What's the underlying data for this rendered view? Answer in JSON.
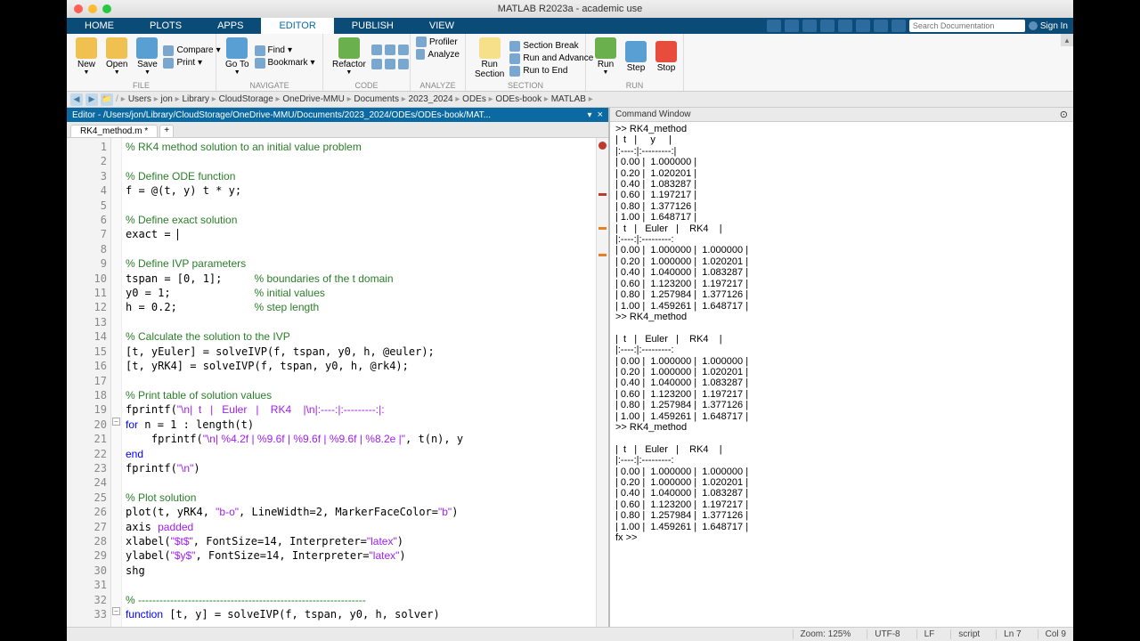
{
  "window_title": "MATLAB R2023a - academic use",
  "tabs": [
    "HOME",
    "PLOTS",
    "APPS",
    "EDITOR",
    "PUBLISH",
    "VIEW"
  ],
  "active_tab": "EDITOR",
  "search_placeholder": "Search Documentation",
  "signin": "Sign In",
  "ribbon": {
    "file": {
      "new": "New",
      "open": "Open",
      "save": "Save",
      "compare": "Compare",
      "print": "Print",
      "label": "FILE"
    },
    "navigate": {
      "goto": "Go To",
      "find": "Find",
      "bookmark": "Bookmark",
      "label": "NAVIGATE"
    },
    "code": {
      "refactor": "Refactor",
      "label": "CODE"
    },
    "analyze": {
      "profiler": "Profiler",
      "analyze": "Analyze",
      "label": "ANALYZE"
    },
    "section": {
      "runsec": "Run\nSection",
      "secbreak": "Section Break",
      "runadv": "Run and Advance",
      "runend": "Run to End",
      "label": "SECTION"
    },
    "run": {
      "run": "Run",
      "step": "Step",
      "stop": "Stop",
      "label": "RUN"
    }
  },
  "breadcrumbs": [
    "Users",
    "jon",
    "Library",
    "CloudStorage",
    "OneDrive-MMU",
    "Documents",
    "2023_2024",
    "ODEs",
    "ODEs-book",
    "MATLAB"
  ],
  "editor_header": "Editor - /Users/jon/Library/CloudStorage/OneDrive-MMU/Documents/2023_2024/ODEs/ODEs-book/MAT...",
  "file_tab": "RK4_method.m *",
  "code_lines": [
    {
      "n": 1,
      "t": "comment",
      "s": "% RK4 method solution to an initial value problem"
    },
    {
      "n": 2,
      "t": "",
      "s": ""
    },
    {
      "n": 3,
      "t": "comment",
      "s": "% Define ODE function"
    },
    {
      "n": 4,
      "t": "code",
      "s": "f = @(t, y) t * y;"
    },
    {
      "n": 5,
      "t": "",
      "s": ""
    },
    {
      "n": 6,
      "t": "comment",
      "s": "% Define exact solution"
    },
    {
      "n": 7,
      "t": "cursor",
      "s": "exact = "
    },
    {
      "n": 8,
      "t": "",
      "s": ""
    },
    {
      "n": 9,
      "t": "comment",
      "s": "% Define IVP parameters"
    },
    {
      "n": 10,
      "t": "mixed",
      "a": "tspan = [0, 1];     ",
      "b": "% boundaries of the t domain"
    },
    {
      "n": 11,
      "t": "mixed",
      "a": "y0 = 1;             ",
      "b": "% initial values"
    },
    {
      "n": 12,
      "t": "mixed",
      "a": "h = 0.2;            ",
      "b": "% step length"
    },
    {
      "n": 13,
      "t": "",
      "s": ""
    },
    {
      "n": 14,
      "t": "comment",
      "s": "% Calculate the solution to the IVP"
    },
    {
      "n": 15,
      "t": "code",
      "s": "[t, yEuler] = solveIVP(f, tspan, y0, h, @euler);"
    },
    {
      "n": 16,
      "t": "code",
      "s": "[t, yRK4] = solveIVP(f, tspan, y0, h, @rk4);"
    },
    {
      "n": 17,
      "t": "",
      "s": ""
    },
    {
      "n": 18,
      "t": "comment",
      "s": "% Print table of solution values"
    },
    {
      "n": 19,
      "t": "fprintf1",
      "a": "fprintf(",
      "b": "\"\\n|  t   |   Euler   |    RK4    |\\n|:----:|:---------:|:",
      "c": ""
    },
    {
      "n": 20,
      "t": "for",
      "a": "for",
      "b": " n = 1 : length(t)"
    },
    {
      "n": 21,
      "t": "fprintf2",
      "a": "    fprintf(",
      "b": "\"\\n| %4.2f | %9.6f | %9.6f | %9.6f | %8.2e |\"",
      "c": ", t(n), y"
    },
    {
      "n": 22,
      "t": "keyword",
      "s": "end"
    },
    {
      "n": 23,
      "t": "fprintf3",
      "a": "fprintf(",
      "b": "\"\\n\"",
      "c": ")"
    },
    {
      "n": 24,
      "t": "",
      "s": ""
    },
    {
      "n": 25,
      "t": "comment",
      "s": "% Plot solution"
    },
    {
      "n": 26,
      "t": "plot",
      "a": "plot(t, yRK4, ",
      "b": "\"b-o\"",
      "c": ", LineWidth=2, MarkerFaceColor=",
      "d": "\"b\"",
      "e": ")"
    },
    {
      "n": 27,
      "t": "axis",
      "a": "axis ",
      "b": "padded"
    },
    {
      "n": 28,
      "t": "label",
      "a": "xlabel(",
      "b": "\"$t$\"",
      "c": ", FontSize=14, Interpreter=",
      "d": "\"latex\"",
      "e": ")"
    },
    {
      "n": 29,
      "t": "label",
      "a": "ylabel(",
      "b": "\"$y$\"",
      "c": ", FontSize=14, Interpreter=",
      "d": "\"latex\"",
      "e": ")"
    },
    {
      "n": 30,
      "t": "code",
      "s": "shg"
    },
    {
      "n": 31,
      "t": "",
      "s": ""
    },
    {
      "n": 32,
      "t": "comment",
      "s": "% ----------------------------------------------------------------"
    },
    {
      "n": 33,
      "t": "func",
      "a": "function",
      "b": " [t, y] = solveIVP(f, tspan, y0, h, solver)"
    }
  ],
  "cmd_header": "Command Window",
  "cmd_output": ">> RK4_method\n|  t   |     y     |\n|:----:|:---------:|\n| 0.00 |  1.000000 |\n| 0.20 |  1.020201 |\n| 0.40 |  1.083287 |\n| 0.60 |  1.197217 |\n| 0.80 |  1.377126 |\n| 1.00 |  1.648717 |\n|  t   |   Euler   |    RK4    |\n|:----:|:---------:\n| 0.00 |  1.000000 |  1.000000 |\n| 0.20 |  1.000000 |  1.020201 |\n| 0.40 |  1.040000 |  1.083287 |\n| 0.60 |  1.123200 |  1.197217 |\n| 0.80 |  1.257984 |  1.377126 |\n| 1.00 |  1.459261 |  1.648717 |\n>> RK4_method\n\n|  t   |   Euler   |    RK4    |\n|:----:|:---------:\n| 0.00 |  1.000000 |  1.000000 |\n| 0.20 |  1.000000 |  1.020201 |\n| 0.40 |  1.040000 |  1.083287 |\n| 0.60 |  1.123200 |  1.197217 |\n| 0.80 |  1.257984 |  1.377126 |\n| 1.00 |  1.459261 |  1.648717 |\n>> RK4_method\n\n|  t   |   Euler   |    RK4    |\n|:----:|:---------:\n| 0.00 |  1.000000 |  1.000000 |\n| 0.20 |  1.000000 |  1.020201 |\n| 0.40 |  1.040000 |  1.083287 |\n| 0.60 |  1.123200 |  1.197217 |\n| 0.80 |  1.257984 |  1.377126 |\n| 1.00 |  1.459261 |  1.648717 |",
  "prompt": "fx >>",
  "status": {
    "zoom": "Zoom: 125%",
    "enc": "UTF-8",
    "le": "LF",
    "type": "script",
    "ln": "Ln  7",
    "col": "Col  9"
  }
}
